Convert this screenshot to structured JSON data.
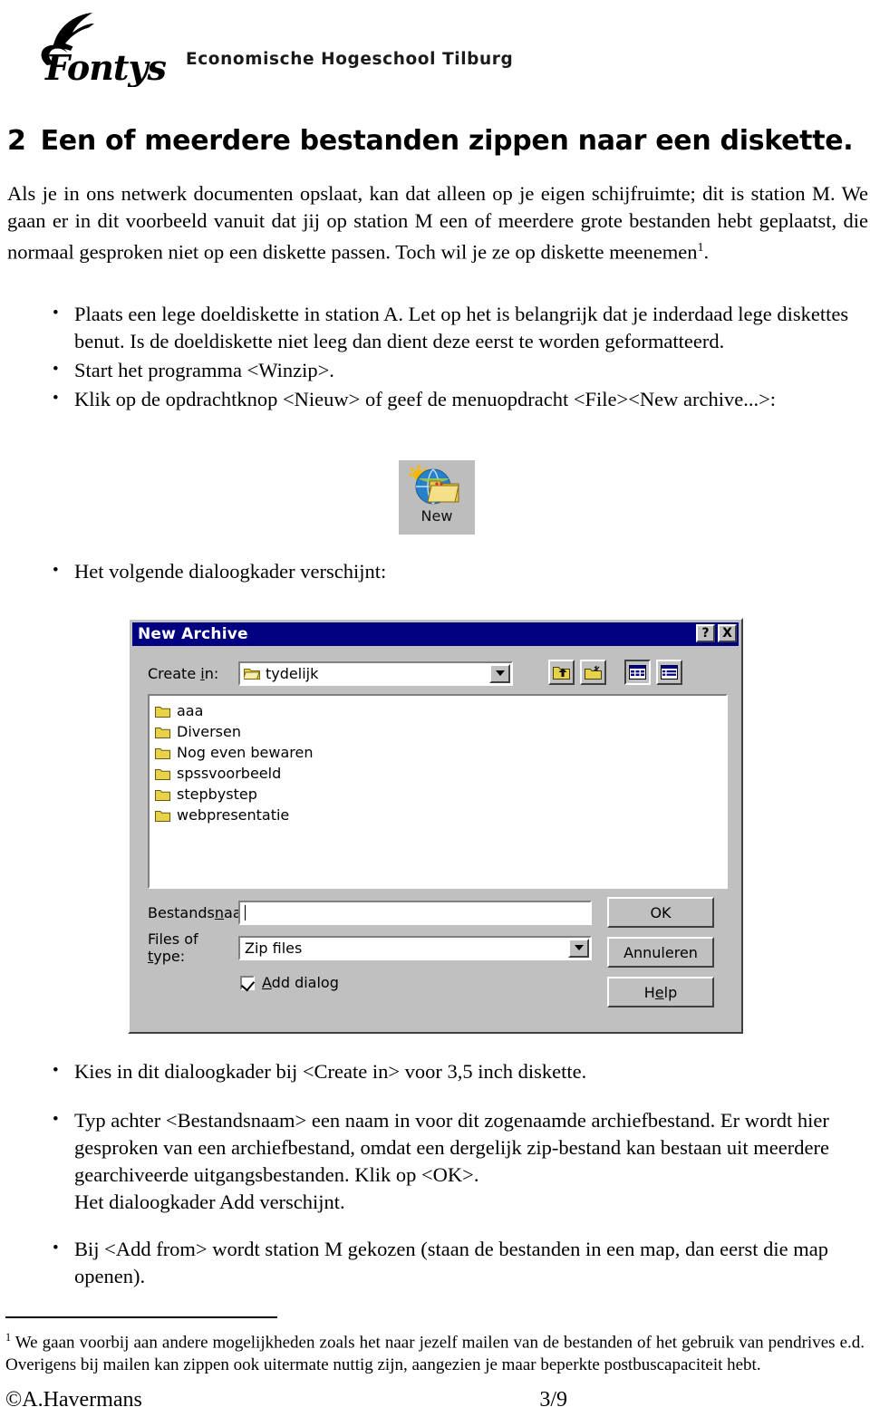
{
  "header": {
    "logo_wordmark": "Fontys",
    "logo_subtitle": "Economische Hogeschool Tilburg"
  },
  "title": {
    "number": "2",
    "text": "Een of meerdere bestanden zippen naar een diskette."
  },
  "intro": {
    "text": "Als je in ons netwerk documenten opslaat, kan dat alleen op je eigen schijfruimte; dit is station M. We gaan er in dit voorbeeld vanuit dat jij op station M een of meerdere grote bestanden hebt geplaatst, die normaal gesproken niet op een diskette passen. Toch wil je ze op diskette meenemen",
    "footnote_marker": "1",
    "tail": "."
  },
  "bullets_top": [
    "Plaats een lege doeldiskette in station A. Let op het is belangrijk dat je inderdaad lege diskettes benut. Is de doeldiskette niet leeg dan dient deze eerst te worden geformatteerd.",
    "Start het programma <Winzip>.",
    "Klik op de opdrachtknop <Nieuw> of geef de menuopdracht <File><New archive...>:"
  ],
  "new_button": {
    "label": "New",
    "icon": "globe-folder-new-icon"
  },
  "bullets_mid": [
    "Het volgende dialoogkader verschijnt:"
  ],
  "dialog": {
    "title": "New Archive",
    "titlebar_color": "#000080",
    "face_color": "#c0c0c0",
    "help_button": "?",
    "close_button": "X",
    "create_in_label_pre": "Create ",
    "create_in_label_accel": "i",
    "create_in_label_post": "n:",
    "create_in_value": "tydelijk",
    "toolbar": [
      {
        "name": "up-one-level-icon",
        "tooltip": "Up One Level"
      },
      {
        "name": "create-new-folder-icon",
        "tooltip": "Create New Folder"
      },
      {
        "name": "list-view-icon",
        "tooltip": "List"
      },
      {
        "name": "details-view-icon",
        "tooltip": "Details"
      }
    ],
    "files": [
      "aaa",
      "Diversen",
      "Nog even bewaren",
      "spssvoorbeeld",
      "stepbystep",
      "webpresentatie"
    ],
    "filename_label_pre": "Bestands",
    "filename_label_accel": "n",
    "filename_label_post": "aam:",
    "filename_value": "",
    "filetype_label_pre": "Files of ",
    "filetype_label_accel": "t",
    "filetype_label_post": "ype:",
    "filetype_value": "Zip files",
    "checkbox_label_accel": "A",
    "checkbox_label_post": "dd dialog",
    "checkbox_checked": true,
    "buttons": {
      "ok": "OK",
      "cancel": "Annuleren",
      "help_pre": "H",
      "help_accel": "e",
      "help_post": "lp"
    }
  },
  "bullets_bottom_1": [
    "Kies in dit dialoogkader bij <Create in> voor 3,5 inch diskette.",
    "Typ achter <Bestandsnaam> een naam in voor dit zogenaamde archiefbestand. Er wordt hier gesproken van een archiefbestand, omdat een dergelijk zip-bestand kan bestaan uit meerdere gearchiveerde uitgangsbestanden. Klik op <OK>."
  ],
  "bullets_bottom_extra": "Het dialoogkader Add verschijnt.",
  "bullets_bottom_2": [
    "Bij <Add from> wordt station M gekozen (staan de bestanden in een map, dan eerst die map openen)."
  ],
  "footnote": {
    "marker": "1",
    "text": " We gaan voorbij aan andere mogelijkheden zoals het naar jezelf mailen van de bestanden of het gebruik van pendrives e.d. Overigens bij mailen kan zippen ook uitermate nuttig zijn, aangezien je maar beperkte postbuscapaciteit hebt."
  },
  "footer": {
    "copyright": "©A.Havermans",
    "page": "3/9"
  }
}
